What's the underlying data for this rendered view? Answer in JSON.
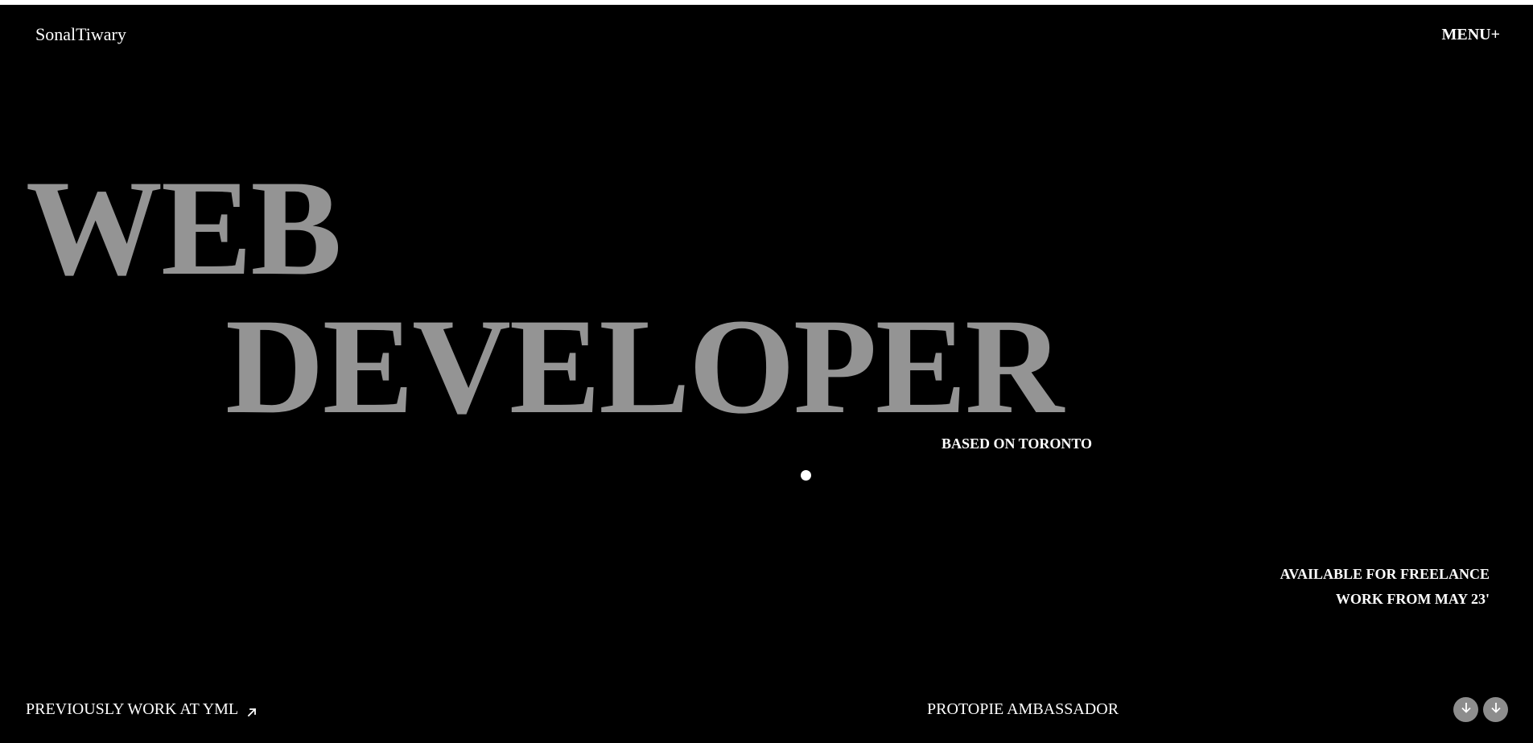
{
  "header": {
    "brand": "SonalTiwary",
    "menu_label": "MENU+"
  },
  "hero": {
    "line1": "WEB",
    "line2": "DEVELOPER",
    "location": "BASED ON TORONTO"
  },
  "availability": {
    "line1": "AVAILABLE FOR FREELANCE",
    "line2": "WORK FROM MAY 23'"
  },
  "footer": {
    "previous_work": "PREVIOUSLY WORK AT YML",
    "previous_work_icon": "arrow-up-right-icon",
    "ambassador": "PROTOPIE AMBASSADOR",
    "scroll_icons": [
      "arrow-down-icon",
      "arrow-down-icon"
    ]
  },
  "colors": {
    "background": "#000000",
    "hero_text": "#949494",
    "text": "#ffffff",
    "button_bg": "#8d8d8d"
  }
}
